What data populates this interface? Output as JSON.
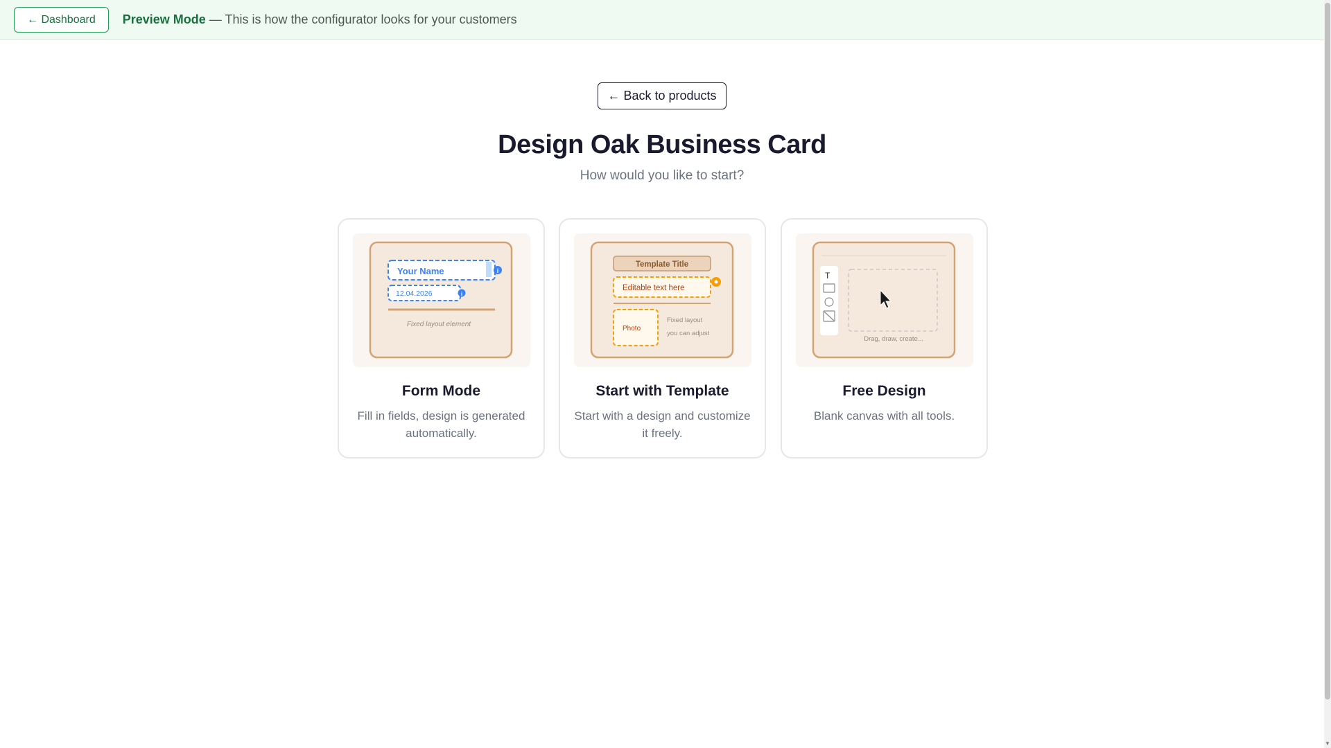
{
  "preview_bar": {
    "dashboard_label": "← Dashboard",
    "mode_label": "Preview Mode",
    "mode_description": " — This is how the configurator looks for your customers"
  },
  "header": {
    "back_label": "← Back to products",
    "title": "Design Oak Business Card",
    "subtitle": "How would you like to start?"
  },
  "cards": [
    {
      "title": "Form Mode",
      "description": "Fill in fields, design is generated automatically.",
      "preview": {
        "name_field": "Your Name",
        "date_field": "12.04.2026",
        "note": "Fixed layout element"
      }
    },
    {
      "title": "Start with Template",
      "description": "Start with a design and customize it freely.",
      "preview": {
        "template_title": "Template Title",
        "editable_text": "Editable text here",
        "photo_label": "Photo",
        "note_line1": "Fixed layout",
        "note_line2": "you can adjust"
      }
    },
    {
      "title": "Free Design",
      "description": "Blank canvas with all tools.",
      "preview": {
        "tool_text_glyph": "T",
        "canvas_caption": "Drag, draw, create..."
      }
    }
  ],
  "colors": {
    "brand_green": "#17703e",
    "preview_bar_bg": "#effaf2",
    "card_paper": "#f5e9dd",
    "card_border": "#d4a373",
    "form_accent": "#3b82f6",
    "template_accent": "#f59e0b"
  },
  "icons": [
    "arrow-left-icon",
    "cursor-arrow-icon",
    "text-tool-icon",
    "rectangle-tool-icon",
    "circle-tool-icon",
    "image-tool-icon",
    "info-icon",
    "plus-badge-icon"
  ]
}
